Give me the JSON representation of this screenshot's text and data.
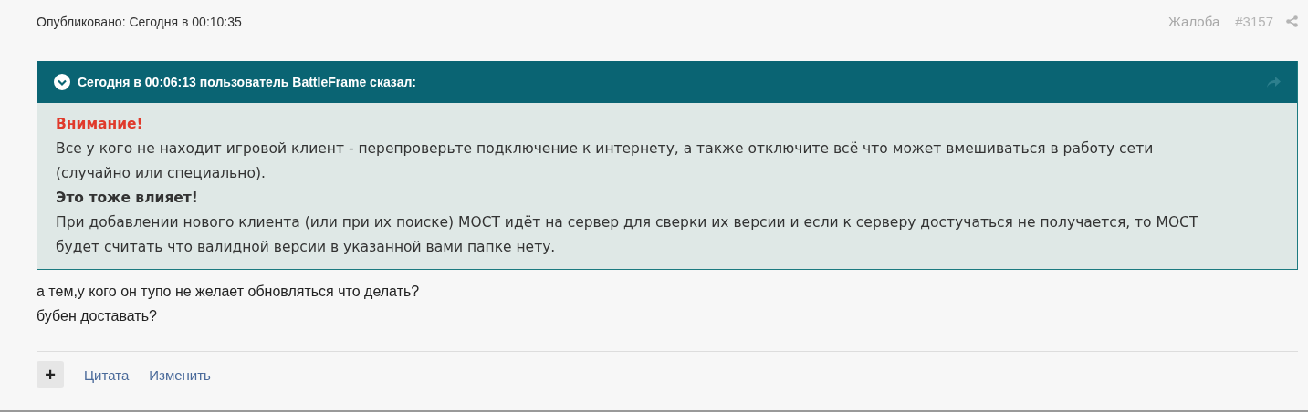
{
  "post": {
    "published": "Опубликовано: Сегодня в 00:10:35",
    "report": "Жалоба",
    "number": "#3157"
  },
  "quote": {
    "header": "Сегодня в 00:06:13 пользователь BattleFrame сказал:",
    "lines": [
      {
        "kind": "warning",
        "text": "Внимание!"
      },
      {
        "kind": "text",
        "text": "Все у кого не находит игровой клиент - перепроверьте подключение к интернету, а также отключите всё что может вмешиваться в работу сети (случайно или специально)."
      },
      {
        "kind": "bold",
        "text": "Это тоже влияет!"
      },
      {
        "kind": "text",
        "text": "При добавлении нового клиента (или при их поиске) МОСТ идёт на сервер для сверки их версии и если к серверу достучаться не получается, то МОСТ будет считать что валидной версии в указанной вами папке нету."
      }
    ]
  },
  "reply": [
    "а тем,у кого он тупо не желает обновляться что делать?",
    "бубен доставать?"
  ],
  "actions": {
    "plus": "+",
    "links": [
      "Цитата",
      "Изменить"
    ]
  }
}
